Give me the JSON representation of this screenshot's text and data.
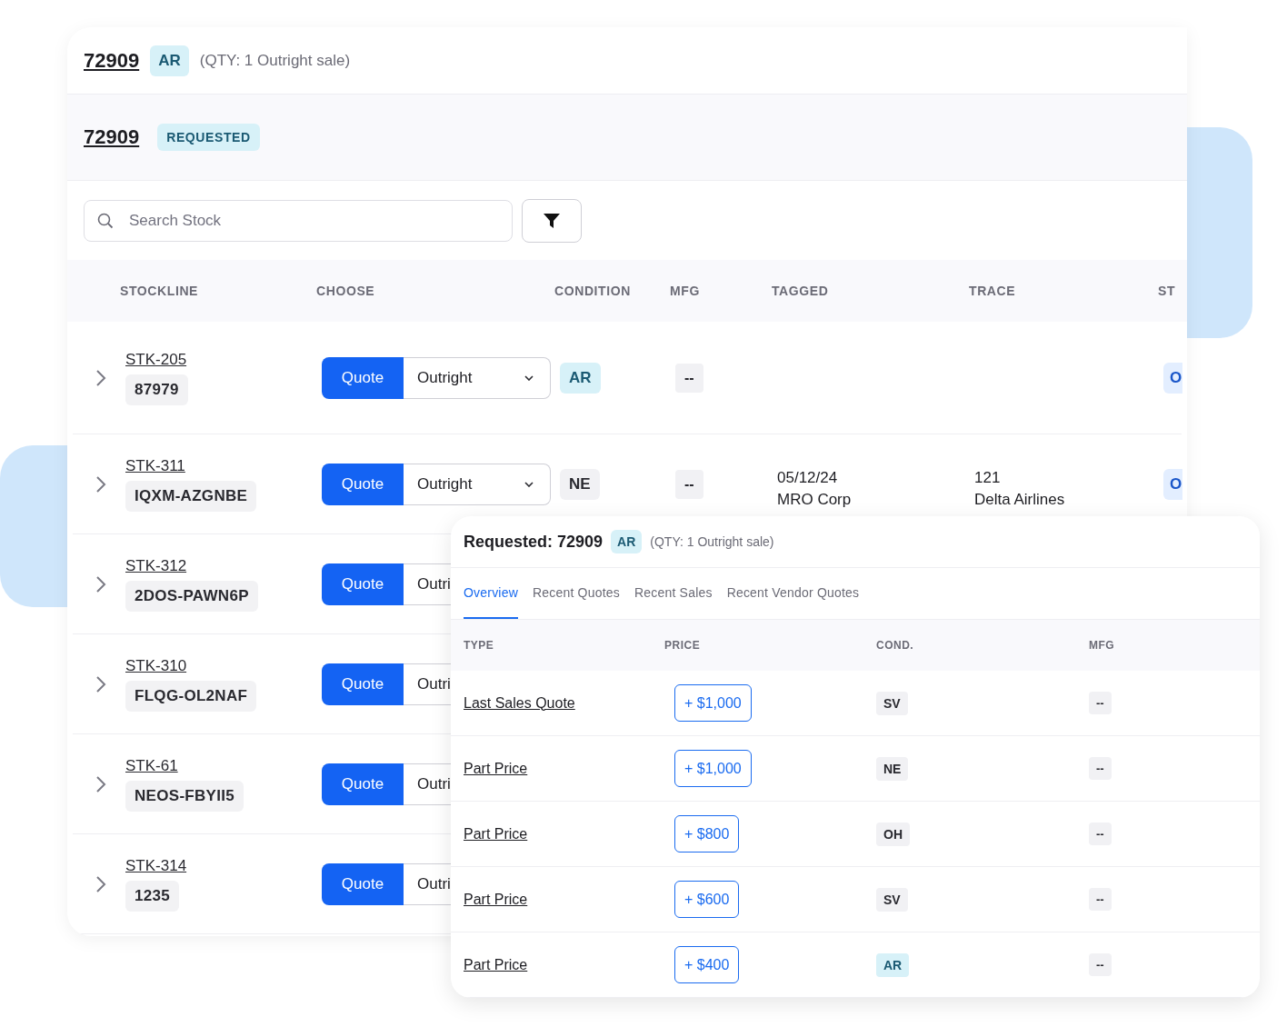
{
  "header": {
    "title": "72909",
    "badge": "AR",
    "note": "(QTY: 1 Outright sale)"
  },
  "request": {
    "title": "72909",
    "status": "REQUESTED"
  },
  "search": {
    "placeholder": "Search Stock"
  },
  "table": {
    "columns": [
      "STOCKLINE",
      "CHOOSE",
      "CONDITION",
      "MFG",
      "TAGGED",
      "TRACE",
      "ST"
    ],
    "rows": [
      {
        "stockline": "STK-205",
        "serial": "87979",
        "action": "Quote",
        "option": "Outright",
        "condition": {
          "text": "AR",
          "color": "#d7f1f8"
        },
        "mfg": "--",
        "status": "O"
      },
      {
        "stockline": "STK-311",
        "serial": "IQXM-AZGNBE",
        "action": "Quote",
        "option": "Outright",
        "condition": {
          "text": "NE",
          "color": "#f1f1f4"
        },
        "mfg": "--",
        "tagged": [
          "05/12/24",
          "MRO Corp"
        ],
        "trace": [
          "121",
          "Delta Airlines"
        ],
        "status": "O"
      },
      {
        "stockline": "STK-312",
        "serial": "2DOS-PAWN6P",
        "action": "Quote",
        "option": "Outri"
      },
      {
        "stockline": "STK-310",
        "serial": "FLQG-OL2NAF",
        "action": "Quote",
        "option": "Outri"
      },
      {
        "stockline": "STK-61",
        "serial": "NEOS-FBYII5",
        "action": "Quote",
        "option": "Outri"
      },
      {
        "stockline": "STK-314",
        "serial": "1235",
        "action": "Quote",
        "option": "Outri"
      }
    ]
  },
  "detail": {
    "title": "Requested: 72909",
    "badge": "AR",
    "note": "(QTY: 1 Outright sale)",
    "tabs": [
      {
        "label": "Overview",
        "selected": true
      },
      {
        "label": "Recent Quotes",
        "selected": false
      },
      {
        "label": "Recent Sales",
        "selected": false
      },
      {
        "label": "Recent Vendor Quotes",
        "selected": false
      }
    ],
    "columns": [
      "TYPE",
      "PRICE",
      "COND.",
      "MFG"
    ],
    "rows": [
      {
        "type": "Last Sales Quote",
        "price": "+ $1,000",
        "condition": {
          "text": "SV",
          "color": "#f1f1f4"
        },
        "mfg": "--"
      },
      {
        "type": "Part Price",
        "price": "+ $1,000",
        "condition": {
          "text": "NE",
          "color": "#f1f1f4"
        },
        "mfg": "--"
      },
      {
        "type": "Part Price",
        "price": "+ $800",
        "condition": {
          "text": "OH",
          "color": "#f1f1f4"
        },
        "mfg": "--"
      },
      {
        "type": "Part Price",
        "price": "+ $600",
        "condition": {
          "text": "SV",
          "color": "#f1f1f4"
        },
        "mfg": "--"
      },
      {
        "type": "Part Price",
        "price": "+ $400",
        "condition": {
          "text": "AR",
          "color": "#d7f1f8"
        },
        "mfg": "--"
      }
    ]
  }
}
